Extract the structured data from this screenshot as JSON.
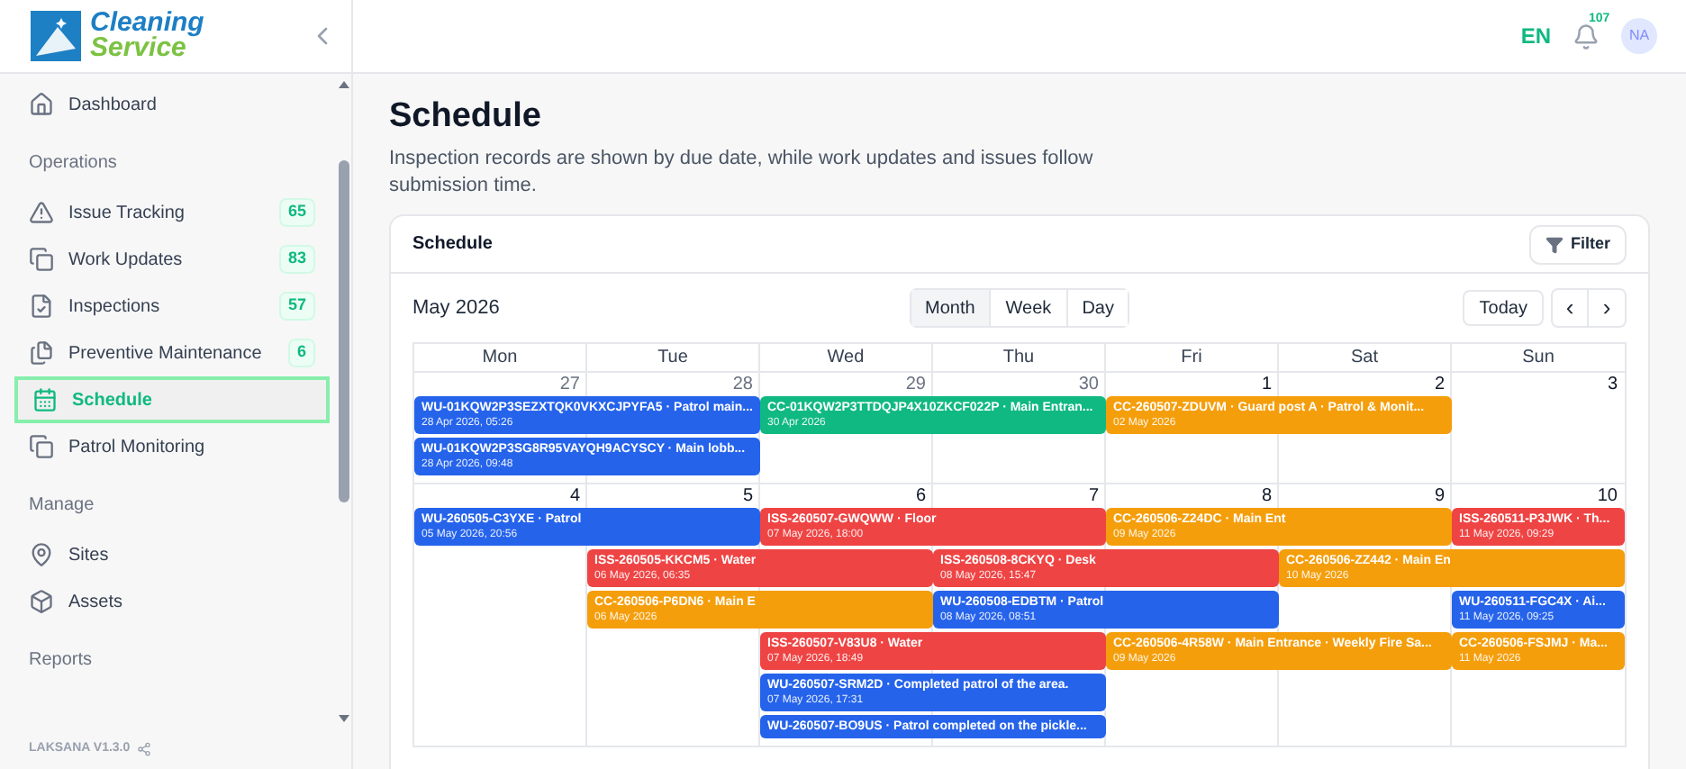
{
  "sidebar": {
    "logo": {
      "line_1": "Cleaning",
      "line_2": "Service"
    },
    "sections": [
      {
        "items": [
          {
            "label": "Dashboard",
            "selected": false
          }
        ]
      },
      {
        "title": "Operations",
        "items": [
          {
            "label": "Issue Tracking",
            "badge": "65",
            "selected": false
          },
          {
            "label": "Work Updates",
            "badge": "83",
            "selected": false
          },
          {
            "label": "Inspections",
            "badge": "57",
            "selected": false
          },
          {
            "label": "Preventive Maintenance",
            "badge": "6",
            "selected": false
          },
          {
            "label": "Schedule",
            "selected": true
          },
          {
            "label": "Patrol Monitoring",
            "selected": false
          }
        ]
      },
      {
        "title": "Manage",
        "items": [
          {
            "label": "Sites",
            "selected": false
          },
          {
            "label": "Assets",
            "selected": false
          }
        ]
      },
      {
        "title": "Reports"
      }
    ],
    "version": "LAKSANA V1.3.0"
  },
  "topbar": {
    "language": {
      "label": "EN",
      "selected": true
    },
    "notifications": "107",
    "avatar": "NA"
  },
  "page": {
    "title": "Schedule",
    "description": "Inspection records are shown by due date, while work updates and issues follow submission time."
  },
  "calendar_card": {
    "title": "Schedule",
    "filter_button": "Filter",
    "month": "May 2026",
    "views": [
      {
        "label": "Month",
        "selected": true
      },
      {
        "label": "Week",
        "selected": false
      },
      {
        "label": "Day",
        "selected": false
      }
    ],
    "today_button": "Today",
    "prev": "‹",
    "next": "›",
    "weekdays": [
      "Mon",
      "Tue",
      "Wed",
      "Thu",
      "Fri",
      "Sat",
      "Sun"
    ],
    "weeks": [
      {
        "days": [
          {
            "number": "27",
            "outside_month": true
          },
          {
            "number": "28",
            "outside_month": true
          },
          {
            "number": "29",
            "outside_month": true
          },
          {
            "number": "30",
            "outside_month": true
          },
          {
            "number": "1",
            "outside_month": false
          },
          {
            "number": "2",
            "outside_month": false
          },
          {
            "number": "3",
            "outside_month": false
          }
        ],
        "events": [
          {
            "title": "WU-01KQW2P3SEZXTQK0VKXCJPYFA5 · Patrol main...",
            "date": "28 Apr 2026, 05:26",
            "color": "#2563eb"
          },
          {
            "title": "WU-01KQW2P3SG8R95VAYQH9ACYSCY · Main lobb...",
            "date": "28 Apr 2026, 09:48",
            "color": "#2563eb"
          },
          {
            "title": "CC-01KQW2P3TTDQJP4X10ZKCF022P · Main Entran...",
            "date": "30 Apr 2026",
            "color": "#10b981"
          },
          {
            "title": "CC-260507-ZDUVM · Guard post A · Patrol & Monit...",
            "date": "02 May 2026",
            "color": "#f59e0b"
          }
        ]
      },
      {
        "days": [
          {
            "number": "4",
            "outside_month": false
          },
          {
            "number": "5",
            "outside_month": false
          },
          {
            "number": "6",
            "outside_month": false
          },
          {
            "number": "7",
            "outside_month": false
          },
          {
            "number": "8",
            "outside_month": false
          },
          {
            "number": "9",
            "outside_month": false
          },
          {
            "number": "10",
            "outside_month": false
          }
        ],
        "events": [
          {
            "title": "WU-260505-C3YXE · Patrol",
            "date": "05 May 2026, 20:56",
            "color": "#2563eb"
          },
          {
            "title": "ISS-260505-KKCM5 · Water",
            "date": "06 May 2026, 06:35",
            "color": "#ef4444"
          },
          {
            "title": "ISS-260507-GWQWW · Floor",
            "date": "07 May 2026, 18:00",
            "color": "#ef4444"
          },
          {
            "title": "ISS-260508-8CKYQ · Desk",
            "date": "08 May 2026, 15:47",
            "color": "#ef4444"
          },
          {
            "title": "CC-260506-P6DN6 · Main E",
            "date": "06 May 2026",
            "color": "#f59e0b"
          },
          {
            "title": "ISS-260507-V83U8 · Water",
            "date": "07 May 2026, 18:49",
            "color": "#ef4444"
          },
          {
            "title": "WU-260508-EDBTM · Patrol",
            "date": "08 May 2026, 08:51",
            "color": "#2563eb"
          },
          {
            "title": "WU-260507-SRM2D · Completed patrol of the area.",
            "date": "07 May 2026, 17:31",
            "color": "#2563eb"
          },
          {
            "title": "WU-260507-BO9US · Patrol completed on the pickle...",
            "color": "#2563eb"
          },
          {
            "title": "CC-260506-Z24DC · Main Ent",
            "date": "09 May 2026",
            "color": "#f59e0b"
          },
          {
            "title": "CC-260506-ZZ442 · Main En",
            "date": "10 May 2026",
            "color": "#f59e0b"
          },
          {
            "title": "CC-260506-4R58W · Main Entrance · Weekly Fire Sa...",
            "date": "09 May 2026",
            "color": "#f59e0b"
          },
          {
            "title": "ISS-260511-P3JWK · Th...",
            "date": "11 May 2026, 09:29",
            "color": "#ef4444"
          },
          {
            "title": "WU-260511-FGC4X · Ai...",
            "date": "11 May 2026, 09:25",
            "color": "#2563eb"
          },
          {
            "title": "CC-260506-FSJMJ · Ma...",
            "date": "11 May 2026",
            "color": "#f59e0b"
          }
        ]
      }
    ]
  }
}
